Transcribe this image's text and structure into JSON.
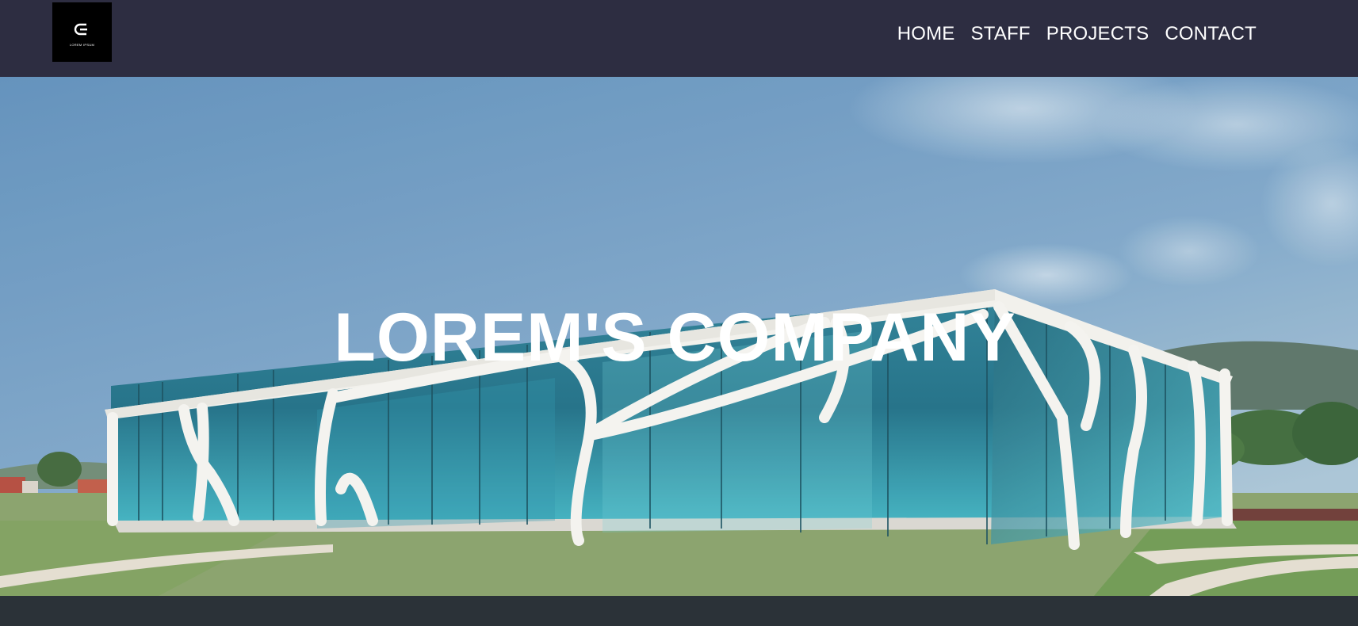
{
  "brand": {
    "logo_text": "LOREM IPSUM"
  },
  "nav": {
    "items": [
      "HOME",
      "STAFF",
      "PROJECTS",
      "CONTACT"
    ]
  },
  "hero": {
    "title": "LOREM'S COMPANY"
  },
  "colors": {
    "topbar": "#2d2d41",
    "footer": "#2b3238",
    "sky": "#6c99bf"
  }
}
